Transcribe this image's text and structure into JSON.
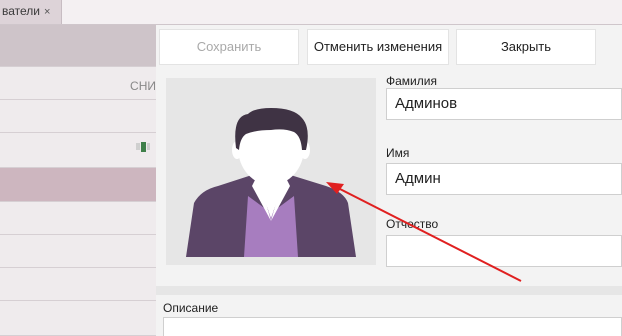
{
  "tab": {
    "label": "ватели",
    "close": "×"
  },
  "left": {
    "column_header": "СНИ",
    "xls_icon": "xls-icon"
  },
  "toolbar": {
    "save": "Сохранить",
    "cancel": "Отменить изменения",
    "close": "Закрыть"
  },
  "form": {
    "surname_label": "Фамилия",
    "surname_value": "Админов",
    "name_label": "Имя",
    "name_value": "Админ",
    "patronymic_label": "Отчество",
    "patronymic_value": "",
    "description_label": "Описание",
    "description_value": ""
  },
  "colors": {
    "accent_arrow": "#e02020",
    "avatar_jacket": "#5b4567",
    "avatar_shirt": "#a77dbf",
    "avatar_hair": "#3f3344"
  }
}
